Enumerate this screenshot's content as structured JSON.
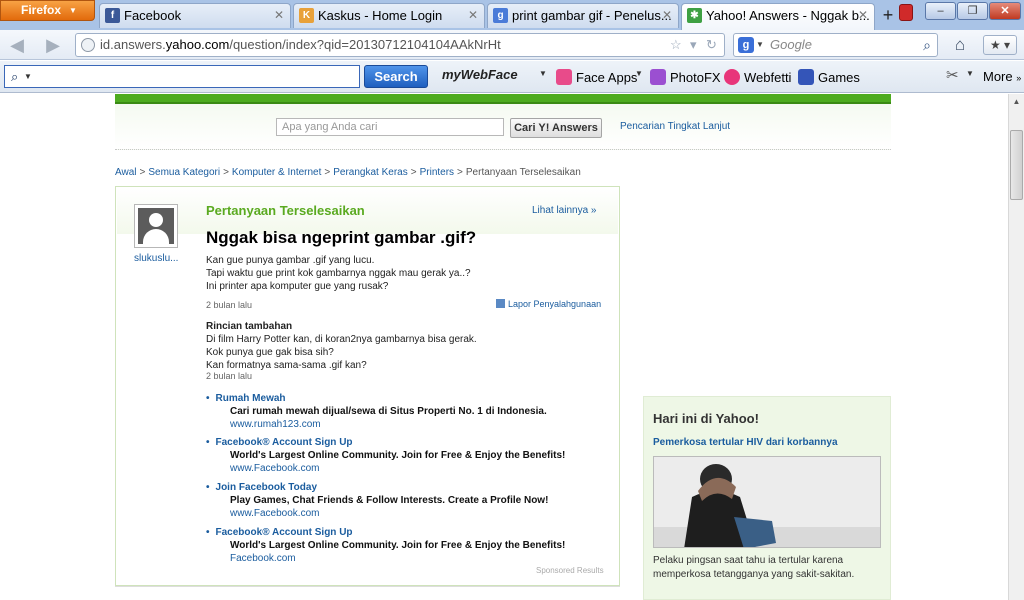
{
  "browser": {
    "menu_button": "Firefox",
    "tabs": [
      {
        "label": "Facebook",
        "icon_color": "#3b5998",
        "icon_glyph": "f"
      },
      {
        "label": "Kaskus - Home Login",
        "icon_color": "#e8a13a",
        "icon_glyph": "K"
      },
      {
        "label": "print gambar gif - Penelus...",
        "icon_color": "#4a7bd8",
        "icon_glyph": "g"
      },
      {
        "label": "Yahoo! Answers - Nggak b...",
        "icon_color": "#3ea043",
        "icon_glyph": "✱",
        "active": true
      }
    ],
    "new_tab": "+",
    "window_buttons": {
      "minimize": "–",
      "maximize": "❐",
      "close": "✕"
    },
    "url": {
      "prefix": "id.answers.",
      "host": "yahoo.com",
      "path": "/question/index?qid=20130712104104AAkNrHt"
    },
    "search_placeholder": "Google",
    "back_icon": "back-arrow-icon",
    "forward_icon": "forward-arrow-icon"
  },
  "toolbar": {
    "search_button": "Search",
    "mywebface": "myWebFace",
    "items": [
      {
        "label": "Face Apps",
        "icon_color": "#e84b8a"
      },
      {
        "label": "PhotoFX",
        "icon_color": "#9b4fd1"
      },
      {
        "label": "Webfetti",
        "icon_color": "#e8357a"
      },
      {
        "label": "Games",
        "icon_color": "#3455b8"
      }
    ],
    "more": "More"
  },
  "site": {
    "search_placeholder": "Apa yang Anda cari",
    "search_button": "Cari Y! Answers",
    "advanced_link": "Pencarian Tingkat Lanjut",
    "breadcrumb": [
      "Awal",
      "Semua Kategori",
      "Komputer & Internet",
      "Perangkat Keras",
      "Printers",
      "Pertanyaan Terselesaikan"
    ],
    "breadcrumb_sep": ">"
  },
  "question": {
    "status": "Pertanyaan Terselesaikan",
    "see_more": "Lihat lainnya »",
    "username": "slukuslu...",
    "title": "Nggak bisa ngeprint gambar .gif?",
    "body": [
      "Kan gue punya gambar .gif yang lucu.",
      "Tapi waktu gue print kok gambarnya nggak mau gerak ya..?",
      "Ini printer apa komputer gue yang rusak?"
    ],
    "time": "2 bulan lalu",
    "report": "Lapor Penyalahgunaan",
    "detail_label": "Rincian tambahan",
    "detail_body": [
      "Di film Harry Potter kan, di koran2nya gambarnya bisa gerak.",
      "Kok punya gue gak bisa sih?",
      "Kan formatnya sama-sama .gif kan?"
    ],
    "detail_time": "2 bulan lalu"
  },
  "sponsored": {
    "items": [
      {
        "title": "Rumah Mewah",
        "desc": "Cari rumah mewah dijual/sewa di Situs Properti No. 1 di Indonesia.",
        "url": "www.rumah123.com"
      },
      {
        "title": "Facebook® Account Sign Up",
        "desc": "World's Largest Online Community. Join for Free & Enjoy the Benefits!",
        "url": "www.Facebook.com"
      },
      {
        "title": "Join Facebook Today",
        "desc": "Play Games, Chat Friends & Follow Interests. Create a Profile Now!",
        "url": "www.Facebook.com"
      },
      {
        "title": "Facebook® Account Sign Up",
        "desc": "World's Largest Online Community. Join for Free & Enjoy the Benefits!",
        "url": "Facebook.com"
      }
    ],
    "label": "Sponsored Results"
  },
  "sidebar": {
    "title": "Hari ini di Yahoo!",
    "headline": "Pemerkosa tertular HIV dari korbannya",
    "caption": "Pelaku pingsan saat tahu ia tertular karena memperkosa tetangganya yang sakit-sakitan."
  }
}
